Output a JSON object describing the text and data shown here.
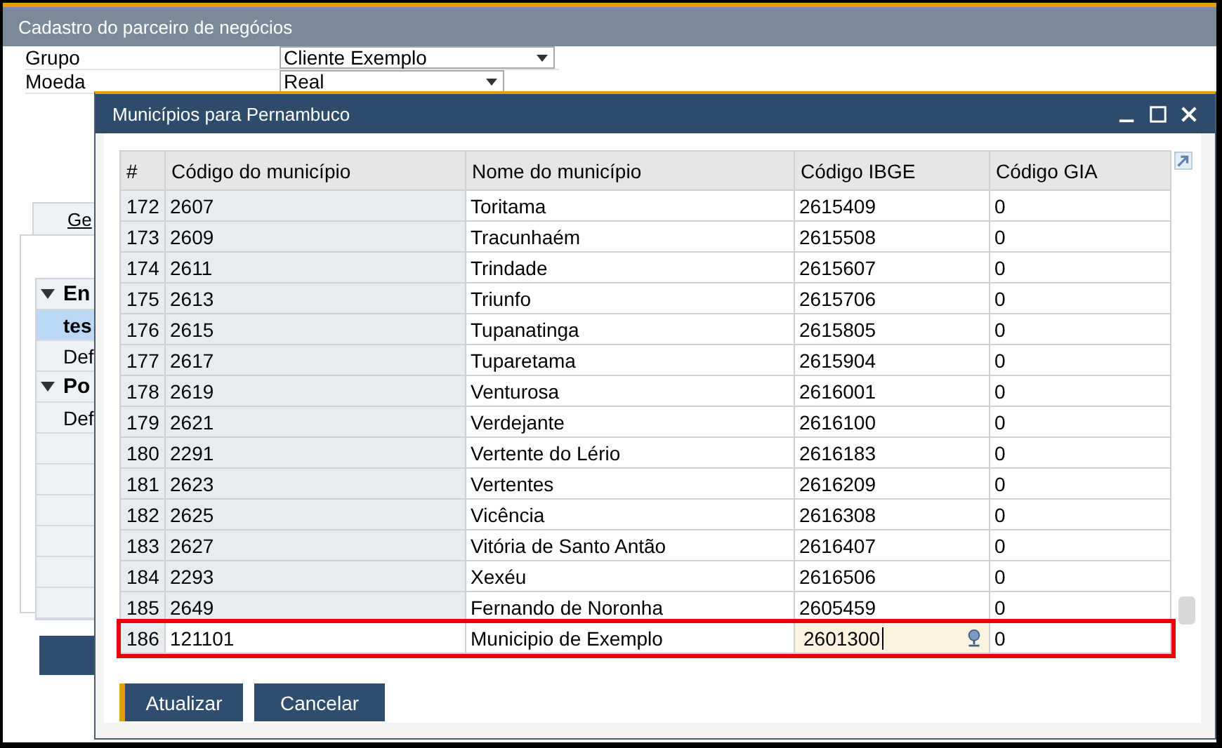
{
  "window": {
    "title": "Cadastro do parceiro de negócios"
  },
  "form_fields": [
    {
      "label": "Grupo",
      "value": "Cliente Exemplo"
    },
    {
      "label": "Moeda",
      "value": "Real"
    }
  ],
  "tabs": [
    {
      "label": "Ge",
      "selected": true
    }
  ],
  "tree": [
    {
      "label": "En",
      "expanded": true,
      "children": [
        {
          "label": "tes",
          "selected": true
        },
        {
          "label": "Def",
          "selected": false
        }
      ]
    },
    {
      "label": "Po",
      "expanded": true,
      "children": [
        {
          "label": "Def",
          "selected": false
        }
      ]
    }
  ],
  "dialog": {
    "title": "Municípios para Pernambuco",
    "table": {
      "columns": [
        "#",
        "Código do município",
        "Nome do município",
        "Código IBGE",
        "Código GIA"
      ],
      "rows": [
        {
          "cells": [
            "172",
            "2607",
            "Toritama",
            "2615409",
            "0"
          ],
          "selected": false
        },
        {
          "cells": [
            "173",
            "2609",
            "Tracunhaém",
            "2615508",
            "0"
          ],
          "selected": false
        },
        {
          "cells": [
            "174",
            "2611",
            "Trindade",
            "2615607",
            "0"
          ],
          "selected": false
        },
        {
          "cells": [
            "175",
            "2613",
            "Triunfo",
            "2615706",
            "0"
          ],
          "selected": false
        },
        {
          "cells": [
            "176",
            "2615",
            "Tupanatinga",
            "2615805",
            "0"
          ],
          "selected": false
        },
        {
          "cells": [
            "177",
            "2617",
            "Tuparetama",
            "2615904",
            "0"
          ],
          "selected": false
        },
        {
          "cells": [
            "178",
            "2619",
            "Venturosa",
            "2616001",
            "0"
          ],
          "selected": false
        },
        {
          "cells": [
            "179",
            "2621",
            "Verdejante",
            "2616100",
            "0"
          ],
          "selected": false
        },
        {
          "cells": [
            "180",
            "2291",
            "Vertente do Lério",
            "2616183",
            "0"
          ],
          "selected": false
        },
        {
          "cells": [
            "181",
            "2623",
            "Vertentes",
            "2616209",
            "0"
          ],
          "selected": false
        },
        {
          "cells": [
            "182",
            "2625",
            "Vicência",
            "2616308",
            "0"
          ],
          "selected": false
        },
        {
          "cells": [
            "183",
            "2627",
            "Vitória de Santo Antão",
            "2616407",
            "0"
          ],
          "selected": false
        },
        {
          "cells": [
            "184",
            "2293",
            "Xexéu",
            "2616506",
            "0"
          ],
          "selected": false
        },
        {
          "cells": [
            "185",
            "2649",
            "Fernando de Noronha",
            "2605459",
            "0"
          ],
          "selected": false
        },
        {
          "cells": [
            "186",
            "121101",
            "Municipio de Exemplo",
            "2601300",
            "0"
          ],
          "selected": true
        }
      ]
    },
    "buttons": [
      {
        "label": "Atualizar",
        "primary": true
      },
      {
        "label": "Cancelar",
        "primary": false
      }
    ]
  }
}
